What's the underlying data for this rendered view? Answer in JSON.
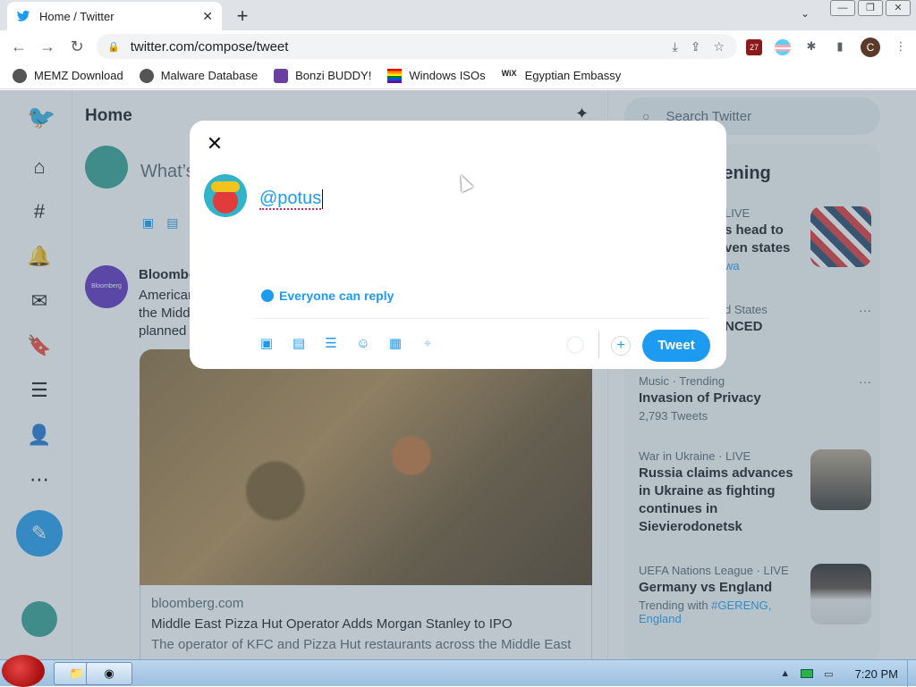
{
  "browser": {
    "tab_title": "Home / Twitter",
    "new_tab": "+",
    "tab_close": "✕",
    "url": "twitter.com/compose/tweet",
    "extension_badge": "27",
    "profile_initial": "C"
  },
  "bookmarks": [
    {
      "label": "MEMZ Download"
    },
    {
      "label": "Malware Database"
    },
    {
      "label": "Bonzi BUDDY!"
    },
    {
      "label": "Windows ISOs"
    },
    {
      "label": "Egyptian Embassy"
    }
  ],
  "twitter": {
    "header": "Home",
    "whats_happening_placeholder": "What’s",
    "post": {
      "avatar_text": "Bloomberg Markets",
      "author": "Bloomberg",
      "text_lines": [
        "American",
        "the Midd",
        "planned"
      ],
      "card_domain": "bloomberg.com",
      "card_title": "Middle East Pizza Hut Operator Adds Morgan Stanley to IPO",
      "card_desc": "The operator of KFC and Pizza Hut restaurants across the Middle East"
    },
    "search_placeholder": "Search Twitter",
    "trends_title": "ppening",
    "trends": [
      {
        "meta": "LIVE",
        "name": "s head to ven states",
        "sub": "wa"
      },
      {
        "meta": "d States",
        "name": "NCED",
        "sub": ""
      },
      {
        "meta": "Music · Trending",
        "name": "Invasion of Privacy",
        "sub": "2,793 Tweets"
      },
      {
        "meta": "War in Ukraine · LIVE",
        "name": "Russia claims advances in Ukraine as fighting continues in Sievierodonetsk",
        "sub": ""
      },
      {
        "meta": "UEFA Nations League · LIVE",
        "name": "Germany vs England",
        "sub_prefix": "Trending with ",
        "sub_hash": "#GERENG",
        "sub_suffix": ", England"
      }
    ]
  },
  "compose": {
    "text": "@potus",
    "reply_setting": "Everyone can reply",
    "tweet_button": "Tweet",
    "add_button": "+",
    "close": "✕"
  },
  "taskbar": {
    "clock": "7:20 PM"
  },
  "colors": {
    "twitter_blue": "#1d9bf0",
    "overlay": "rgba(91,112,131,0.40)"
  }
}
